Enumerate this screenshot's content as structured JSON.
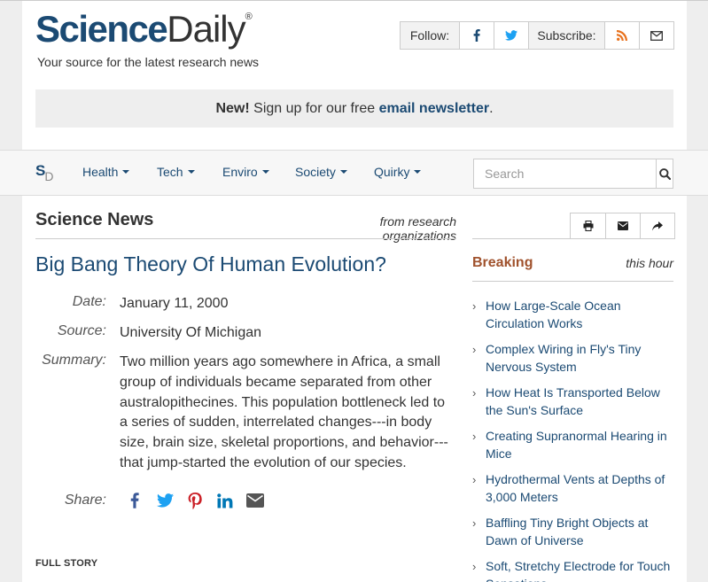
{
  "header": {
    "logo_science": "Science",
    "logo_daily": "Daily",
    "logo_reg": "®",
    "tagline": "Your source for the latest research news",
    "follow_label": "Follow:",
    "subscribe_label": "Subscribe:"
  },
  "newsletter": {
    "new": "New!",
    "text": " Sign up for our free ",
    "link": "email newsletter",
    "end": "."
  },
  "nav": {
    "mark_s": "S",
    "mark_d": "D",
    "items": [
      "Health",
      "Tech",
      "Enviro",
      "Society",
      "Quirky"
    ],
    "search_placeholder": "Search"
  },
  "main": {
    "section_title": "Science News",
    "section_sub": "from research organizations",
    "headline": "Big Bang Theory Of Human Evolution?",
    "date_label": "Date:",
    "date": "January 11, 2000",
    "source_label": "Source:",
    "source": "University Of Michigan",
    "summary_label": "Summary:",
    "summary": "Two million years ago somewhere in Africa, a small group of individuals became separated from other australopithecines. This population bottleneck led to a series of sudden, interrelated changes---in body size, brain size, skeletal proportions, and behavior---that jump-started the evolution of our species.",
    "share_label": "Share:",
    "full_story": "FULL STORY"
  },
  "sidebar": {
    "breaking": "Breaking",
    "this_hour": "this hour",
    "items": [
      "How Large-Scale Ocean Circulation Works",
      "Complex Wiring in Fly's Tiny Nervous System",
      "How Heat Is Transported Below the Sun's Surface",
      "Creating Supranormal Hearing in Mice",
      "Hydrothermal Vents at Depths of 3,000 Meters",
      "Baffling Tiny Bright Objects at Dawn of Universe",
      "Soft, Stretchy Electrode for Touch Sensations"
    ]
  },
  "colors": {
    "brand_blue": "#1b4a73",
    "breaking": "#a0522d",
    "facebook": "#3b5998",
    "twitter": "#1da1f2",
    "pinterest": "#cb2027",
    "linkedin": "#0077b5",
    "email": "#555555"
  }
}
